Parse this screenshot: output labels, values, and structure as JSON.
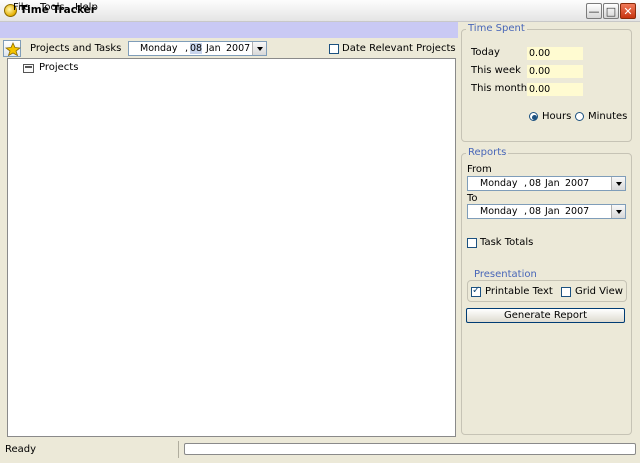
{
  "window": {
    "title": "Time Tracker"
  },
  "menu": {
    "file": "File",
    "tools": "Tools",
    "help": "Help"
  },
  "toolbar": {
    "label": "Projects and Tasks",
    "date": {
      "day": "Monday",
      "sep": ",",
      "dnum": "08",
      "month": "Jan",
      "year": "2007"
    },
    "relevant_label": "Date Relevant Projects",
    "relevant_checked": false
  },
  "tree": {
    "root": "Projects"
  },
  "time_spent": {
    "legend": "Time Spent",
    "rows": [
      {
        "label": "Today",
        "value": "0.00"
      },
      {
        "label": "This week",
        "value": "0.00"
      },
      {
        "label": "This month",
        "value": "0.00"
      }
    ],
    "hours_label": "Hours",
    "minutes_label": "Minutes",
    "selected_unit": "Hours"
  },
  "reports": {
    "legend": "Reports",
    "from_label": "From",
    "from": {
      "day": "Monday",
      "sep": ",",
      "dnum": "08",
      "month": "Jan",
      "year": "2007"
    },
    "to_label": "To",
    "to": {
      "day": "Monday",
      "sep": ",",
      "dnum": "08",
      "month": "Jan",
      "year": "2007"
    },
    "task_totals_label": "Task Totals",
    "task_totals_checked": false,
    "presentation": {
      "legend": "Presentation",
      "printable_label": "Printable Text",
      "printable_checked": true,
      "grid_label": "Grid View",
      "grid_checked": false
    },
    "generate_label": "Generate Report"
  },
  "status": {
    "text": "Ready"
  },
  "colors": {
    "menubar": "#c9c9f4",
    "legend": "#4866b8",
    "value_bg": "#fffbd1",
    "close": "#c73410"
  }
}
